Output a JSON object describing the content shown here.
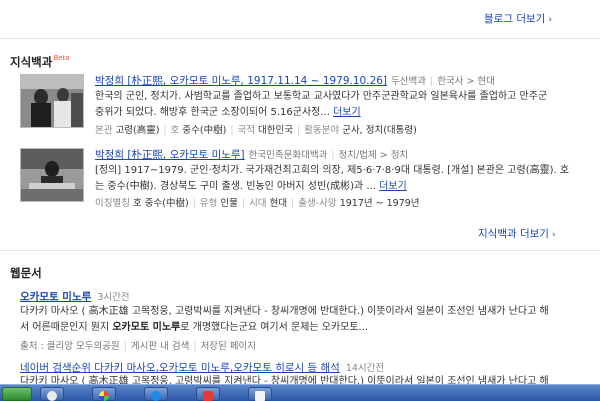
{
  "blog": {
    "more_label": "블로그 더보기"
  },
  "encyclopedia": {
    "title": "지식백과",
    "beta": "Beta",
    "more_label": "지식백과 더보기",
    "items": [
      {
        "title": "박정희 [朴正熙, 오카모토 미노루, 1917.11.14 ~ 1979.10.26]",
        "source": "두산백과",
        "category": "한국사 > 현대",
        "desc_line1": "한국의 군인, 정치가. 사범학교를 졸업하고 보통학교 교사였다가 만주군관학교와 일본육사를 졸업하고 만주군",
        "desc_line2": "중위가 되었다. 해방후 한국군 소장이되어 5.16군사정...",
        "more": "더보기",
        "attrs": [
          {
            "k": "본관",
            "v": "고령(高靈)"
          },
          {
            "k": "호",
            "v": "중수(中樹)"
          },
          {
            "k": "국적",
            "v": "대한민국"
          },
          {
            "k": "활동분야",
            "v": "군사, 정치(대통령)"
          }
        ]
      },
      {
        "title": "박정희 [朴正熙, 오카모토 미노루]",
        "source": "한국민족문화대백과",
        "category": "정치/법제 > 정치",
        "desc_line1": "[정의] 1917~1979. 군인·정치가. 국가재건최고회의 의장, 제5·6·7·8·9대 대통령. [개설] 본관은 고령(高靈). 호",
        "desc_line2": "는 중수(中樹). 경상북도 구미 출생. 빈농인 아버지 성빈(成彬)과 ...",
        "more": "더보기",
        "attrs": [
          {
            "k": "이칭별칭",
            "v": "호 중수(中樹)"
          },
          {
            "k": "유형",
            "v": "인물"
          },
          {
            "k": "시대",
            "v": "현대"
          },
          {
            "k": "출생-사망",
            "v": "1917년 ~ 1979년"
          }
        ]
      }
    ]
  },
  "webdocs": {
    "title": "웹문서",
    "items": [
      {
        "title": "오카모토 미노루",
        "time": "3시간전",
        "desc_line1": "다카키 마사오 ( 高木正雄 고목정웅, 고령박씨를 지켜낸다 - 창씨개명에 반대한다.) 이뜻이라서 일본이 조선인 냄새가 난다고 해",
        "desc_line2_a": "서 어른때문인지 뭔지 ",
        "desc_line2_b": "오카모토 미노루",
        "desc_line2_c": "로 개명했다는군요 여기서 문제는 오카모토...",
        "src": [
          "출처 : 클리앙 모두의공원",
          "게시판 내 검색",
          "저장된 페이지"
        ]
      },
      {
        "title": "네이버 검색순위 다카키 마사오,오카모토 미노루,오카모토 히로시 등 해석",
        "time": "14시간전",
        "desc_line1": "다카키 마사오 ( 高木正雄 고목정웅, 고령박씨를 지켜낸다 - 창씨개명에 반대한다.) 이뜻이라서 일본이 조선인 냄새가 난다고 해"
      }
    ]
  },
  "taskbar": {
    "colors": {
      "top": "#5a86c9",
      "bottom": "#2a56a6"
    }
  }
}
